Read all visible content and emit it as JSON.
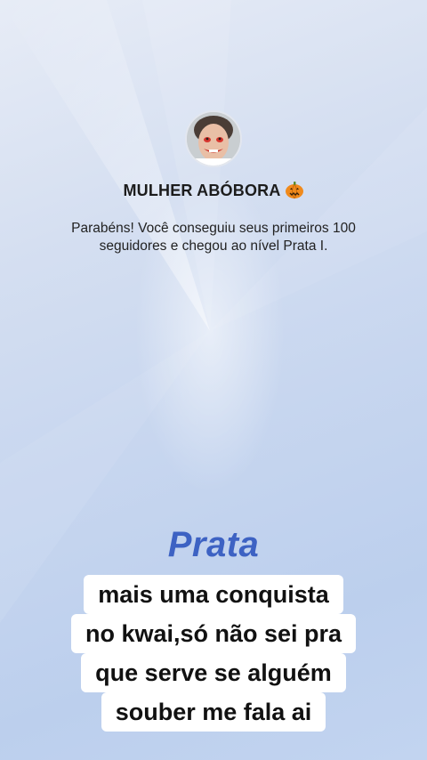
{
  "profile": {
    "username": "MULHER ABÓBORA",
    "emoji_icon": "pumpkin-icon"
  },
  "achievement": {
    "message": "Parabéns! Você conseguiu seus primeiros 100 seguidores e chegou ao nível Prata I.",
    "level_title": "Prata"
  },
  "caption": {
    "lines": [
      "mais uma conquista",
      "no kwai,só não sei pra",
      "que serve se alguém",
      "souber me fala ai"
    ]
  },
  "colors": {
    "level_title": "#3d62c3",
    "background_top": "#e7ecf6",
    "background_bottom": "#c2d4f0"
  }
}
